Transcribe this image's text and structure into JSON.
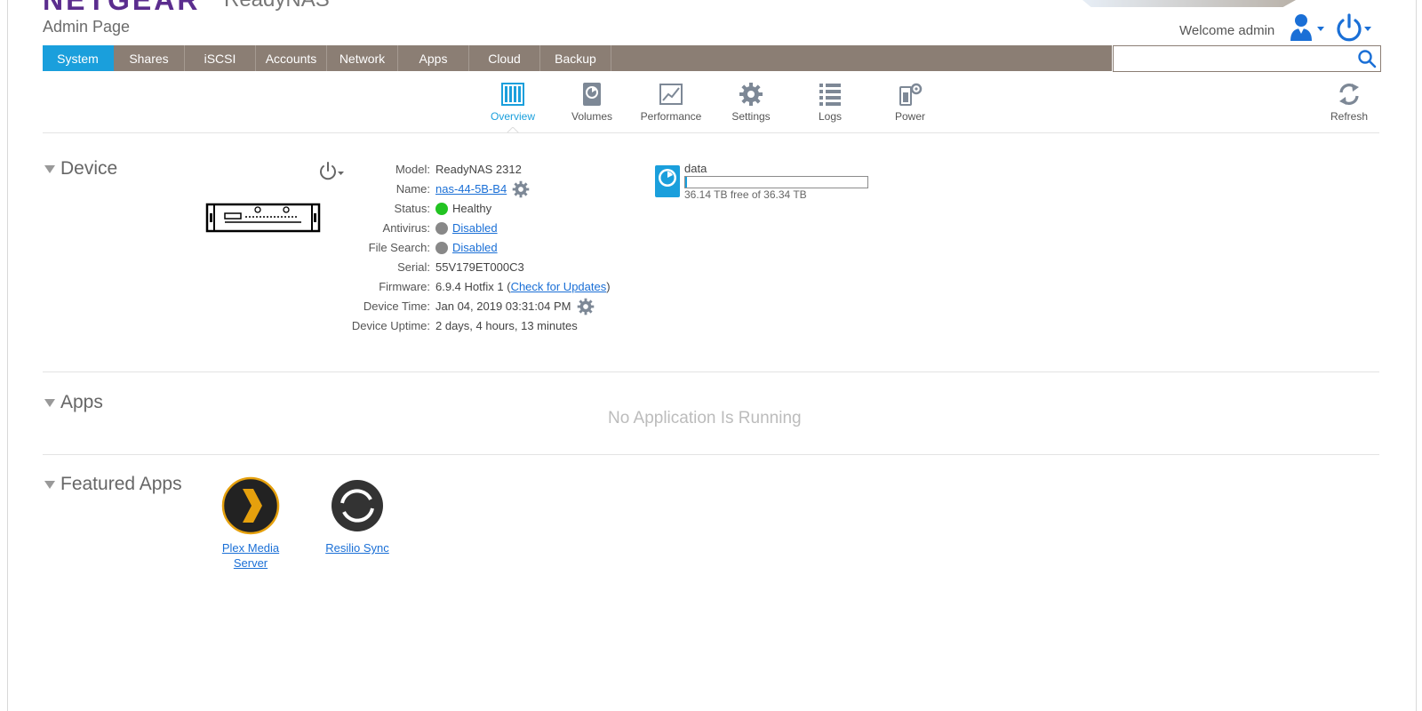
{
  "header": {
    "brand": "NETGEAR",
    "product": "ReadyNAS",
    "page_title": "Admin Page",
    "welcome": "Welcome admin"
  },
  "nav": {
    "tabs": [
      "System",
      "Shares",
      "iSCSI",
      "Accounts",
      "Network",
      "Apps",
      "Cloud",
      "Backup"
    ],
    "active": "System"
  },
  "search": {
    "value": "",
    "placeholder": ""
  },
  "subnav": {
    "overview": "Overview",
    "volumes": "Volumes",
    "performance": "Performance",
    "settings": "Settings",
    "logs": "Logs",
    "power": "Power",
    "refresh": "Refresh"
  },
  "device": {
    "title": "Device",
    "rows": [
      {
        "key": "Model:",
        "value": "ReadyNAS 2312"
      },
      {
        "key": "Name:",
        "value": "nas-44-5B-B4"
      },
      {
        "key": "Status:",
        "value": "Healthy",
        "color": "#22c322"
      },
      {
        "key": "Antivirus:",
        "value": "Disabled",
        "color": "#888888"
      },
      {
        "key": "File Search:",
        "value": "Disabled",
        "color": "#888888"
      },
      {
        "key": "Serial:",
        "value": "55V179ET000C3"
      },
      {
        "key": "Firmware:",
        "value": "6.9.4 Hotfix 1",
        "link": "Check for Updates"
      },
      {
        "key": "Device Time:",
        "value": "Jan 04, 2019 03:31:04 PM"
      },
      {
        "key": "Device Uptime:",
        "value": "2 days, 4 hours, 13 minutes"
      }
    ]
  },
  "volume": {
    "name": "data",
    "free_text": "36.14 TB free of 36.34 TB",
    "used_fraction": 0.006
  },
  "apps": {
    "title": "Apps",
    "empty_text": "No Application Is Running"
  },
  "featured": {
    "title": "Featured Apps",
    "items": [
      {
        "line1": "Plex Media",
        "line2": "Server"
      },
      {
        "line1": "Resilio Sync"
      }
    ]
  },
  "colors": {
    "accent": "#1a9fdc",
    "nav_bg": "#8b7e74",
    "brand": "#5b2d8e",
    "link": "#1a6fd6"
  }
}
